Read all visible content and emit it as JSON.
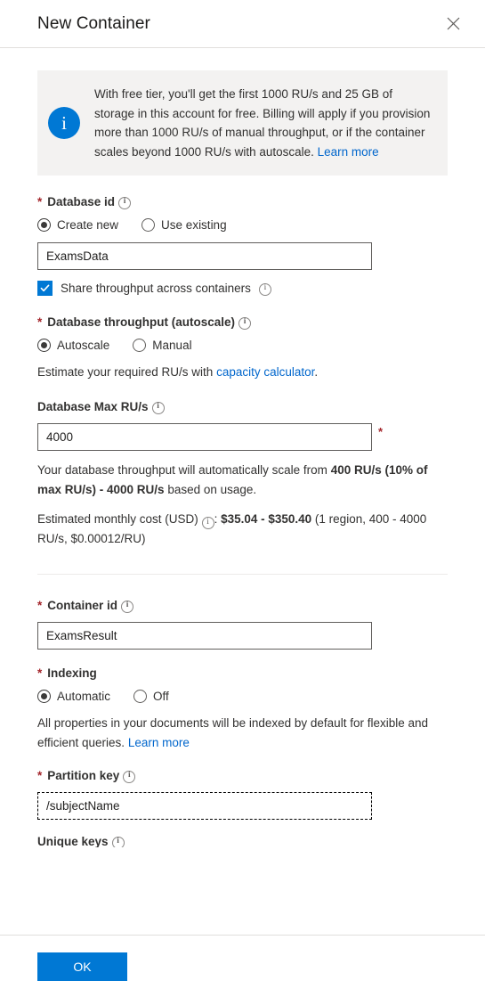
{
  "header": {
    "title": "New Container",
    "close_label": "×"
  },
  "info_banner": {
    "icon": "info-circle-icon",
    "glyph": "i",
    "text": "With free tier, you'll get the first 1000 RU/s and 25 GB of storage in this account for free. Billing will apply if you provision more than 1000 RU/s of manual throughput, or if the container scales beyond 1000 RU/s with autoscale. ",
    "link_label": "Learn more"
  },
  "database_id": {
    "label": "Database id",
    "required_mark": "*",
    "info_icon": "info-icon",
    "options": [
      {
        "label": "Create new",
        "selected": true
      },
      {
        "label": "Use existing",
        "selected": false
      }
    ],
    "value": "ExamsData",
    "placeholder": "Type a new database id",
    "share_throughput": {
      "label": "Share throughput across containers",
      "checked": true,
      "info_icon": "info-icon"
    }
  },
  "database_throughput": {
    "label": "Database throughput (autoscale)",
    "required_mark": "*",
    "info_icon": "info-icon",
    "options": [
      {
        "label": "Autoscale",
        "selected": true
      },
      {
        "label": "Manual",
        "selected": false
      }
    ],
    "estimate_prefix": "Estimate your required RU/s with ",
    "estimate_link": "capacity calculator",
    "estimate_suffix": ".",
    "max_ru_label": "Database Max RU/s",
    "max_ru_info_icon": "info-icon",
    "max_ru_value": "4000",
    "max_ru_required_mark": "*",
    "scale_help_pre": "Your database throughput will automatically scale from ",
    "scale_help_bold": "400 RU/s (10% of max RU/s) - 4000 RU/s",
    "scale_help_post": " based on usage.",
    "cost_label": "Estimated monthly cost (USD) ",
    "cost_info_icon": "info-icon",
    "cost_colon": ": ",
    "cost_bold": "$35.04 - $350.40",
    "cost_detail": " (1 region, 400 - 4000 RU/s, $0.00012/RU)"
  },
  "container_id": {
    "label": "Container id",
    "required_mark": "*",
    "info_icon": "info-icon",
    "value": "ExamsResult",
    "placeholder": "e.g. Container1"
  },
  "indexing": {
    "label": "Indexing",
    "required_mark": "*",
    "options": [
      {
        "label": "Automatic",
        "selected": true
      },
      {
        "label": "Off",
        "selected": false
      }
    ],
    "help_pre": "All properties in your documents will be indexed by default for flexible and efficient queries. ",
    "help_link": "Learn more"
  },
  "partition_key": {
    "label": "Partition key",
    "required_mark": "*",
    "info_icon": "info-icon",
    "value": "/subjectName",
    "placeholder": "e.g. /address/zipCode",
    "focused": true
  },
  "unique_keys": {
    "label": "Unique keys",
    "info_icon": "info-icon"
  },
  "footer": {
    "ok_label": "OK"
  },
  "colors": {
    "accent": "#0078d4",
    "link": "#0066cc",
    "required": "#a4262c",
    "banner_bg": "#f3f2f1",
    "border": "#605e5c",
    "divider": "#e1dfdd"
  }
}
